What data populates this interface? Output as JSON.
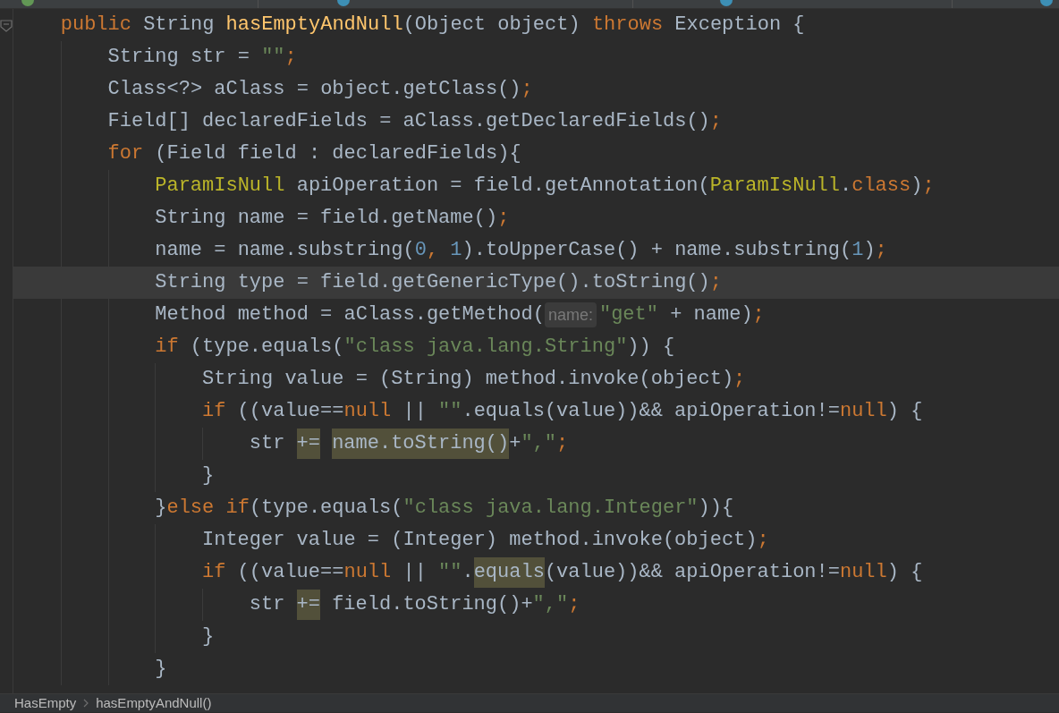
{
  "editor": {
    "lines": [
      {
        "current": false,
        "tokens": [
          {
            "kind": "kw",
            "text": "public "
          },
          {
            "kind": "plain",
            "text": "String "
          },
          {
            "kind": "fn",
            "text": "hasEmptyAndNull"
          },
          {
            "kind": "plain",
            "text": "(Object object) "
          },
          {
            "kind": "kw",
            "text": "throws "
          },
          {
            "kind": "plain",
            "text": "Exception {"
          }
        ],
        "children": [
          {
            "current": false,
            "tokens": [
              {
                "kind": "plain",
                "text": "String str = "
              },
              {
                "kind": "str",
                "text": "\"\""
              },
              {
                "kind": "kw",
                "text": ";"
              }
            ]
          },
          {
            "current": false,
            "tokens": [
              {
                "kind": "plain",
                "text": "Class<?> aClass = object.getClass()"
              },
              {
                "kind": "kw",
                "text": ";"
              }
            ]
          },
          {
            "current": false,
            "tokens": [
              {
                "kind": "plain",
                "text": "Field[] declaredFields = aClass.getDeclaredFields()"
              },
              {
                "kind": "kw",
                "text": ";"
              }
            ]
          },
          {
            "current": false,
            "tokens": [
              {
                "kind": "kw",
                "text": "for "
              },
              {
                "kind": "plain",
                "text": "(Field field : declaredFields){"
              }
            ],
            "children": [
              {
                "current": false,
                "tokens": [
                  {
                    "kind": "ann",
                    "text": "ParamIsNull "
                  },
                  {
                    "kind": "plain",
                    "text": "apiOperation = field.getAnnotation("
                  },
                  {
                    "kind": "ann",
                    "text": "ParamIsNull"
                  },
                  {
                    "kind": "plain",
                    "text": "."
                  },
                  {
                    "kind": "kw",
                    "text": "class"
                  },
                  {
                    "kind": "plain",
                    "text": ")"
                  },
                  {
                    "kind": "kw",
                    "text": ";"
                  }
                ]
              },
              {
                "current": false,
                "tokens": [
                  {
                    "kind": "plain",
                    "text": "String name = field.getName()"
                  },
                  {
                    "kind": "kw",
                    "text": ";"
                  }
                ]
              },
              {
                "current": false,
                "tokens": [
                  {
                    "kind": "plain",
                    "text": "name = name.substring("
                  },
                  {
                    "kind": "num",
                    "text": "0"
                  },
                  {
                    "kind": "kw",
                    "text": ", "
                  },
                  {
                    "kind": "num",
                    "text": "1"
                  },
                  {
                    "kind": "plain",
                    "text": ").toUpperCase() + name.substring("
                  },
                  {
                    "kind": "num",
                    "text": "1"
                  },
                  {
                    "kind": "plain",
                    "text": ")"
                  },
                  {
                    "kind": "kw",
                    "text": ";"
                  }
                ]
              },
              {
                "current": true,
                "tokens": [
                  {
                    "kind": "plain",
                    "text": "String type = field.getGenericType().toString()"
                  },
                  {
                    "kind": "kw",
                    "text": ";"
                  }
                ]
              },
              {
                "current": false,
                "tokens": [
                  {
                    "kind": "plain",
                    "text": "Method method = aClass.getMethod("
                  },
                  {
                    "kind": "hint",
                    "text": "name:"
                  },
                  {
                    "kind": "str",
                    "text": "\"get\" "
                  },
                  {
                    "kind": "plain",
                    "text": "+ name)"
                  },
                  {
                    "kind": "kw",
                    "text": ";"
                  }
                ]
              },
              {
                "current": false,
                "tokens": [
                  {
                    "kind": "kw",
                    "text": "if "
                  },
                  {
                    "kind": "plain",
                    "text": "(type.equals("
                  },
                  {
                    "kind": "str",
                    "text": "\"class java.lang.String\""
                  },
                  {
                    "kind": "plain",
                    "text": ")) {"
                  }
                ],
                "children": [
                  {
                    "current": false,
                    "tokens": [
                      {
                        "kind": "plain",
                        "text": "String value = (String) method.invoke(object)"
                      },
                      {
                        "kind": "kw",
                        "text": ";"
                      }
                    ]
                  },
                  {
                    "current": false,
                    "tokens": [
                      {
                        "kind": "kw",
                        "text": "if "
                      },
                      {
                        "kind": "plain",
                        "text": "((value=="
                      },
                      {
                        "kind": "kw",
                        "text": "null "
                      },
                      {
                        "kind": "plain",
                        "text": "|| "
                      },
                      {
                        "kind": "str",
                        "text": "\"\""
                      },
                      {
                        "kind": "plain",
                        "text": ".equals(value))&& apiOperation!="
                      },
                      {
                        "kind": "kw",
                        "text": "null"
                      },
                      {
                        "kind": "plain",
                        "text": ") {"
                      }
                    ],
                    "children": [
                      {
                        "current": false,
                        "tokens": [
                          {
                            "kind": "plain",
                            "text": "str "
                          },
                          {
                            "kind": "usage",
                            "text": "+="
                          },
                          {
                            "kind": "usage",
                            "text": "name.toString()"
                          },
                          {
                            "kind": "plain",
                            "text": "+"
                          },
                          {
                            "kind": "str",
                            "text": "\",\""
                          },
                          {
                            "kind": "kw",
                            "text": ";"
                          }
                        ]
                      }
                    ]
                  },
                  {
                    "current": false,
                    "tokens": [
                      {
                        "kind": "plain",
                        "text": "}"
                      }
                    ]
                  }
                ]
              },
              {
                "current": false,
                "tokens": [
                  {
                    "kind": "plain",
                    "text": "}"
                  },
                  {
                    "kind": "kw",
                    "text": "else if"
                  },
                  {
                    "kind": "plain",
                    "text": "(type.equals("
                  },
                  {
                    "kind": "str",
                    "text": "\"class java.lang.Integer\""
                  },
                  {
                    "kind": "plain",
                    "text": ")){"
                  }
                ],
                "children": [
                  {
                    "current": false,
                    "tokens": [
                      {
                        "kind": "plain",
                        "text": "Integer value = (Integer) method.invoke(object)"
                      },
                      {
                        "kind": "kw",
                        "text": ";"
                      }
                    ]
                  },
                  {
                    "current": false,
                    "tokens": [
                      {
                        "kind": "kw",
                        "text": "if "
                      },
                      {
                        "kind": "plain",
                        "text": "((value=="
                      },
                      {
                        "kind": "kw",
                        "text": "null "
                      },
                      {
                        "kind": "plain",
                        "text": "|| "
                      },
                      {
                        "kind": "str",
                        "text": "\"\""
                      },
                      {
                        "kind": "plain",
                        "text": "."
                      },
                      {
                        "kind": "usage",
                        "text": "equals"
                      },
                      {
                        "kind": "plain",
                        "text": "(value))&& apiOperation!="
                      },
                      {
                        "kind": "kw",
                        "text": "null"
                      },
                      {
                        "kind": "plain",
                        "text": ") {"
                      }
                    ],
                    "children": [
                      {
                        "current": false,
                        "tokens": [
                          {
                            "kind": "plain",
                            "text": "str "
                          },
                          {
                            "kind": "usage",
                            "text": "+="
                          },
                          {
                            "kind": "plain",
                            "text": " field.toString()+"
                          },
                          {
                            "kind": "str",
                            "text": "\",\""
                          },
                          {
                            "kind": "kw",
                            "text": ";"
                          }
                        ]
                      }
                    ]
                  },
                  {
                    "current": false,
                    "tokens": [
                      {
                        "kind": "plain",
                        "text": "}"
                      }
                    ]
                  }
                ]
              },
              {
                "current": false,
                "tokens": [
                  {
                    "kind": "plain",
                    "text": "}"
                  }
                ]
              }
            ]
          }
        ]
      }
    ]
  },
  "breadcrumb": [
    "HasEmpty",
    "hasEmptyAndNull()"
  ]
}
